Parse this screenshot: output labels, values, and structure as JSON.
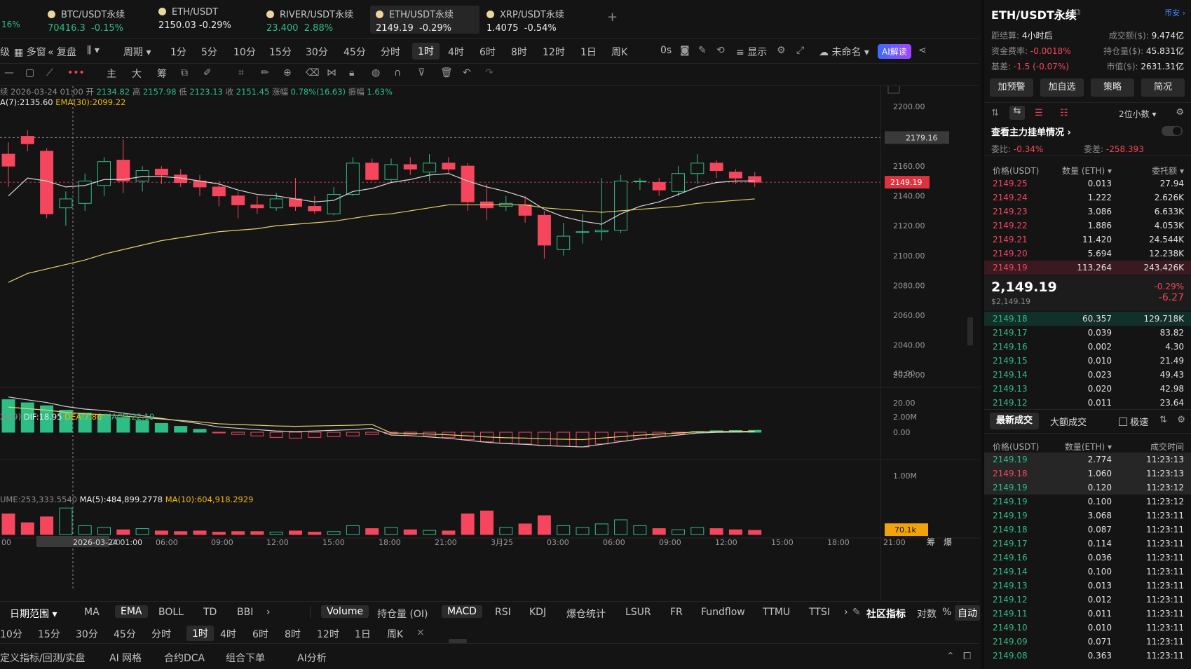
{
  "tabs": [
    {
      "name": "BTC/USDT永续",
      "price": "70416.3",
      "change": "-0.15%",
      "dir": "down",
      "left_pct": "16%"
    },
    {
      "name": "ETH/USDT",
      "price": "2150.03",
      "change": "-0.29%",
      "dir": "down"
    },
    {
      "name": "RIVER/USDT永续",
      "price": "23.400",
      "change": "2.88%",
      "dir": "up"
    },
    {
      "name": "ETH/USDT永续",
      "price": "2149.19",
      "change": "-0.29%",
      "dir": "down"
    },
    {
      "name": "XRP/USDT永续",
      "price": "1.4075",
      "change": "-0.54%",
      "dir": "down"
    }
  ],
  "toolbar": {
    "left_items": [
      "级",
      "多窗",
      "复盘",
      "周期"
    ],
    "intervals": [
      "1分",
      "5分",
      "10分",
      "15分",
      "30分",
      "45分",
      "分时",
      "1时",
      "4时",
      "6时",
      "8时",
      "12时",
      "1日",
      "周K"
    ],
    "selected_interval": "1时",
    "countdown": "0s",
    "display": "显示",
    "layout_name": "未命名",
    "ai_label": "AI解读",
    "draw_labels": [
      "主",
      "大",
      "筹"
    ]
  },
  "info_line": {
    "prefix": "续",
    "date": "2026-03-24 01:00",
    "open_label": "开",
    "open": "2134.82",
    "high_label": "高",
    "high": "2157.98",
    "low_label": "低",
    "low": "2123.13",
    "close_label": "收",
    "close": "2151.45",
    "chg_label": "涨幅",
    "chg": "0.78%(16.63)",
    "amp_label": "振幅",
    "amp": "1.63%"
  },
  "ema_line": {
    "ema7": "A(7):2135.60",
    "ema30": "EMA(30):2099.22"
  },
  "macd_line": {
    "prefix": "26,9)",
    "dif": "DIF:18.95",
    "dea": "DEA:7.86",
    "macd": "MACD:22.19"
  },
  "vol_line": {
    "vol": "UME:253,333.5540",
    "ma5": "MA(5):484,899.2778",
    "ma10": "MA(10):604,918.2929"
  },
  "price_axis": [
    "2200.00",
    "2180.00",
    "2160.00",
    "2140.00",
    "2120.00",
    "2100.00",
    "2080.00",
    "2060.00",
    "2040.00",
    "2020.00"
  ],
  "crosshair_price": "2179.16",
  "current_price_tag": "2149.19",
  "macd_axis": [
    "40.00",
    "20.00",
    "0.00"
  ],
  "vol_axis": [
    "2.00M",
    "1.00M"
  ],
  "vol_tag": "70.1k",
  "time_axis": [
    "00",
    "2026-03-24 01:00",
    "00",
    "06:00",
    "09:00",
    "12:00",
    "15:00",
    "18:00",
    "21:00",
    "3月25",
    "03:00",
    "06:00",
    "09:00",
    "12:00",
    "15:00",
    "18:00",
    "21:00"
  ],
  "time_axis_right": [
    "筹",
    "爆"
  ],
  "chart_data": {
    "type": "candlestick",
    "interval": "1h",
    "candles": [
      [
        2168,
        2176,
        2146,
        2160
      ],
      [
        2180,
        2184,
        2170,
        2175
      ],
      [
        2170,
        2172,
        2125,
        2128
      ],
      [
        2132,
        2143,
        2120,
        2138
      ],
      [
        2135,
        2155,
        2130,
        2150
      ],
      [
        2147,
        2166,
        2140,
        2163
      ],
      [
        2164,
        2178,
        2142,
        2150
      ],
      [
        2150,
        2160,
        2143,
        2157
      ],
      [
        2158,
        2160,
        2148,
        2154
      ],
      [
        2154,
        2158,
        2146,
        2149
      ],
      [
        2150,
        2154,
        2140,
        2146
      ],
      [
        2146,
        2150,
        2133,
        2140
      ],
      [
        2140,
        2143,
        2125,
        2134
      ],
      [
        2134,
        2140,
        2128,
        2132
      ],
      [
        2132,
        2142,
        2130,
        2138
      ],
      [
        2138,
        2152,
        2130,
        2133
      ],
      [
        2133,
        2140,
        2128,
        2130
      ],
      [
        2128,
        2146,
        2127,
        2141
      ],
      [
        2141,
        2166,
        2140,
        2162
      ],
      [
        2162,
        2165,
        2150,
        2151
      ],
      [
        2151,
        2165,
        2149,
        2161
      ],
      [
        2161,
        2166,
        2154,
        2158
      ],
      [
        2156,
        2168,
        2150,
        2162
      ],
      [
        2162,
        2166,
        2155,
        2158
      ],
      [
        2160,
        2162,
        2130,
        2136
      ],
      [
        2136,
        2148,
        2124,
        2132
      ],
      [
        2133,
        2140,
        2130,
        2135
      ],
      [
        2134,
        2140,
        2122,
        2127
      ],
      [
        2127,
        2130,
        2098,
        2107
      ],
      [
        2104,
        2122,
        2100,
        2113
      ],
      [
        2116,
        2128,
        2108,
        2116
      ],
      [
        2116,
        2152,
        2110,
        2117
      ],
      [
        2117,
        2154,
        2115,
        2150
      ],
      [
        2150,
        2152,
        2144,
        2150
      ],
      [
        2149,
        2152,
        2140,
        2144
      ],
      [
        2143,
        2160,
        2140,
        2155
      ],
      [
        2155,
        2168,
        2148,
        2162
      ],
      [
        2162,
        2164,
        2152,
        2157
      ],
      [
        2156,
        2158,
        2148,
        2152
      ],
      [
        2153,
        2156,
        2146,
        2149.19
      ]
    ],
    "ema7": [
      2140,
      2152,
      2150,
      2146,
      2147,
      2151,
      2151,
      2153,
      2153,
      2152,
      2150,
      2148,
      2144,
      2141,
      2140,
      2138,
      2136,
      2137,
      2143,
      2145,
      2149,
      2151,
      2154,
      2155,
      2150,
      2146,
      2143,
      2139,
      2131,
      2126,
      2123,
      2121,
      2128,
      2133,
      2136,
      2141,
      2146,
      2149,
      2150,
      2150
    ],
    "ema30": [
      2082,
      2088,
      2091,
      2094,
      2097,
      2101,
      2104,
      2107,
      2110,
      2112,
      2114,
      2116,
      2117,
      2118,
      2120,
      2121,
      2122,
      2123,
      2125,
      2127,
      2128,
      2130,
      2132,
      2134,
      2134,
      2134,
      2134,
      2134,
      2132,
      2131,
      2130,
      2129,
      2130,
      2131,
      2132,
      2133,
      2135,
      2136,
      2137,
      2138
    ],
    "macd_hist": [
      22.19,
      20,
      18,
      15,
      13,
      12,
      10,
      8,
      6,
      4,
      2,
      -0.5,
      -1.5,
      -2.5,
      -3.5,
      -4,
      -3.5,
      -3,
      -2.5,
      -1.5,
      -1,
      -1.5,
      -2.5,
      -3.5,
      -5,
      -6.5,
      -7.5,
      -8,
      -9,
      -9.5,
      -10,
      -8,
      -6,
      -4,
      -2.5,
      -1,
      0.5,
      1,
      1.2,
      1.3
    ],
    "volume": [
      0.35,
      0.2,
      0.3,
      0.45,
      0.15,
      0.12,
      0.08,
      0.1,
      0.06,
      0.05,
      0.06,
      0.04,
      0.05,
      0.05,
      0.04,
      0.06,
      0.04,
      0.05,
      0.15,
      0.1,
      0.12,
      0.08,
      0.07,
      0.06,
      0.35,
      0.4,
      0.12,
      0.18,
      0.32,
      0.15,
      0.12,
      0.18,
      0.25,
      0.15,
      0.1,
      0.08,
      0.12,
      0.1,
      0.08,
      0.07
    ]
  },
  "symbol_panel": {
    "title": "ETH/USDT永续",
    "exchange": "币安",
    "settle_label": "距结算:",
    "settle_val": "4小时后",
    "turnover_label": "成交额($):",
    "turnover_val": "9.474亿",
    "funding_label": "资金费率:",
    "funding_val": "-0.0018%",
    "oi_label": "持仓量($):",
    "oi_val": "45.831亿",
    "basis_label": "基差:",
    "basis_val": "-1.5 (-0.07%)",
    "mcap_label": "市值($):",
    "mcap_val": "2631.31亿",
    "buttons": [
      "加预警",
      "加自选",
      "策略",
      "简况"
    ],
    "decimals": "2位小数",
    "main_orders": "查看主力挂单情况",
    "ratio_label": "委比:",
    "ratio_val": "-0.34%",
    "diff_label": "委差:",
    "diff_val": "-258.393",
    "ob_headers": [
      "价格(USDT)",
      "数量 (ETH)",
      "委托额"
    ],
    "asks": [
      [
        "2149.25",
        "0.013",
        "27.94"
      ],
      [
        "2149.24",
        "1.222",
        "2.626K"
      ],
      [
        "2149.23",
        "3.086",
        "6.633K"
      ],
      [
        "2149.22",
        "1.886",
        "4.053K"
      ],
      [
        "2149.21",
        "11.420",
        "24.544K"
      ],
      [
        "2149.20",
        "5.694",
        "12.238K"
      ],
      [
        "2149.19",
        "113.264",
        "243.426K"
      ]
    ],
    "mid_price": "2,149.19",
    "mid_usd": "$2,149.19",
    "mid_pct": "-0.29%",
    "mid_chg": "-6.27",
    "bids": [
      [
        "2149.18",
        "60.357",
        "129.718K"
      ],
      [
        "2149.17",
        "0.039",
        "83.82"
      ],
      [
        "2149.16",
        "0.002",
        "4.30"
      ],
      [
        "2149.15",
        "0.010",
        "21.49"
      ],
      [
        "2149.14",
        "0.023",
        "49.43"
      ],
      [
        "2149.13",
        "0.020",
        "42.98"
      ],
      [
        "2149.12",
        "0.011",
        "23.64"
      ]
    ],
    "trade_tabs": [
      "最新成交",
      "大额成交"
    ],
    "fast_label": "极速",
    "trade_headers": [
      "价格(USDT)",
      "数量(ETH)",
      "成交时间"
    ],
    "trades": [
      [
        "2149.19",
        "2.774",
        "11:23:13",
        "up"
      ],
      [
        "2149.18",
        "1.060",
        "11:23:13",
        "down"
      ],
      [
        "2149.19",
        "0.120",
        "11:23:12",
        "up"
      ],
      [
        "2149.19",
        "0.100",
        "11:23:12",
        "up"
      ],
      [
        "2149.19",
        "3.068",
        "11:23:11",
        "up"
      ],
      [
        "2149.18",
        "0.087",
        "11:23:11",
        "up"
      ],
      [
        "2149.17",
        "0.114",
        "11:23:11",
        "up"
      ],
      [
        "2149.16",
        "0.036",
        "11:23:11",
        "up"
      ],
      [
        "2149.14",
        "0.100",
        "11:23:11",
        "up"
      ],
      [
        "2149.13",
        "0.013",
        "11:23:11",
        "up"
      ],
      [
        "2149.12",
        "0.012",
        "11:23:11",
        "up"
      ],
      [
        "2149.11",
        "0.011",
        "11:23:11",
        "up"
      ],
      [
        "2149.10",
        "0.010",
        "11:23:11",
        "up"
      ],
      [
        "2149.09",
        "0.071",
        "11:23:11",
        "up"
      ],
      [
        "2149.08",
        "0.363",
        "11:23:11",
        "up"
      ]
    ]
  },
  "bottom": {
    "range": "日期范围",
    "indicators": [
      "MA",
      "EMA",
      "BOLL",
      "TD",
      "BBI"
    ],
    "selected_main": "EMA",
    "sub_indicators": [
      "Volume",
      "持仓量 (OI)",
      "MACD",
      "RSI",
      "KDJ",
      "爆仓统计",
      "LSUR",
      "FR",
      "Fundflow",
      "TTMU",
      "TTSI"
    ],
    "community": "社区指标",
    "log_label": "对数",
    "pct_label": "%",
    "auto_label": "自动",
    "intervals": [
      "10分",
      "15分",
      "30分",
      "45分",
      "分时",
      "1时",
      "4时",
      "6时",
      "8时",
      "12时",
      "1日",
      "周K"
    ],
    "selected_interval": "1时",
    "close_x": "×",
    "tools": [
      "定义指标/回测/实盘",
      "AI 网格",
      "合约DCA",
      "组合下单",
      "AI分析"
    ]
  }
}
